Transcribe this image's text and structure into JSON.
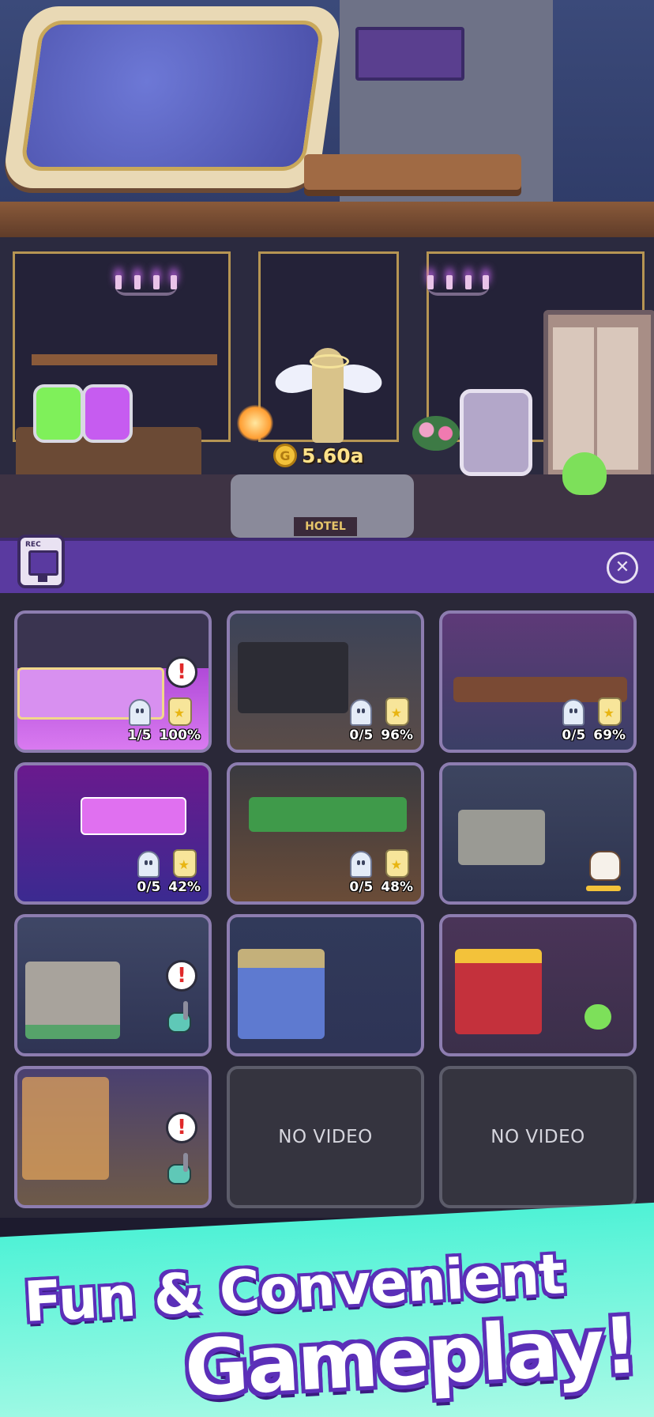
{
  "hud": {
    "earnings": "5.60a",
    "desk_sign": "HOTEL"
  },
  "panel": {
    "rec_label": "REC",
    "close_symbol": "✕"
  },
  "rooms": [
    {
      "ghosts": "1/5",
      "percent": "100%",
      "alert": true
    },
    {
      "ghosts": "0/5",
      "percent": "96%"
    },
    {
      "ghosts": "0/5",
      "percent": "69%"
    },
    {
      "ghosts": "0/5",
      "percent": "42%"
    },
    {
      "ghosts": "0/5",
      "percent": "48%"
    },
    {
      "status": "cleaning"
    },
    {
      "alert": true,
      "status": "needs-cleaning"
    },
    {
      "status": "idle"
    },
    {
      "status": "idle"
    },
    {
      "alert": true,
      "status": "needs-cleaning"
    },
    {
      "label": "NO VIDEO"
    },
    {
      "label": "NO VIDEO"
    }
  ],
  "icons": {
    "alert": "!",
    "coin": "G"
  },
  "banner": {
    "line1": "Fun & Convenient",
    "line2": "Gameplay!"
  },
  "colors": {
    "panel_header": "#5a3aa0",
    "tile_border": "#8d7db0",
    "banner_bg": "#4ff2d6",
    "banner_outline": "#5b2fb8",
    "earnings_text": "#ffe28a"
  }
}
